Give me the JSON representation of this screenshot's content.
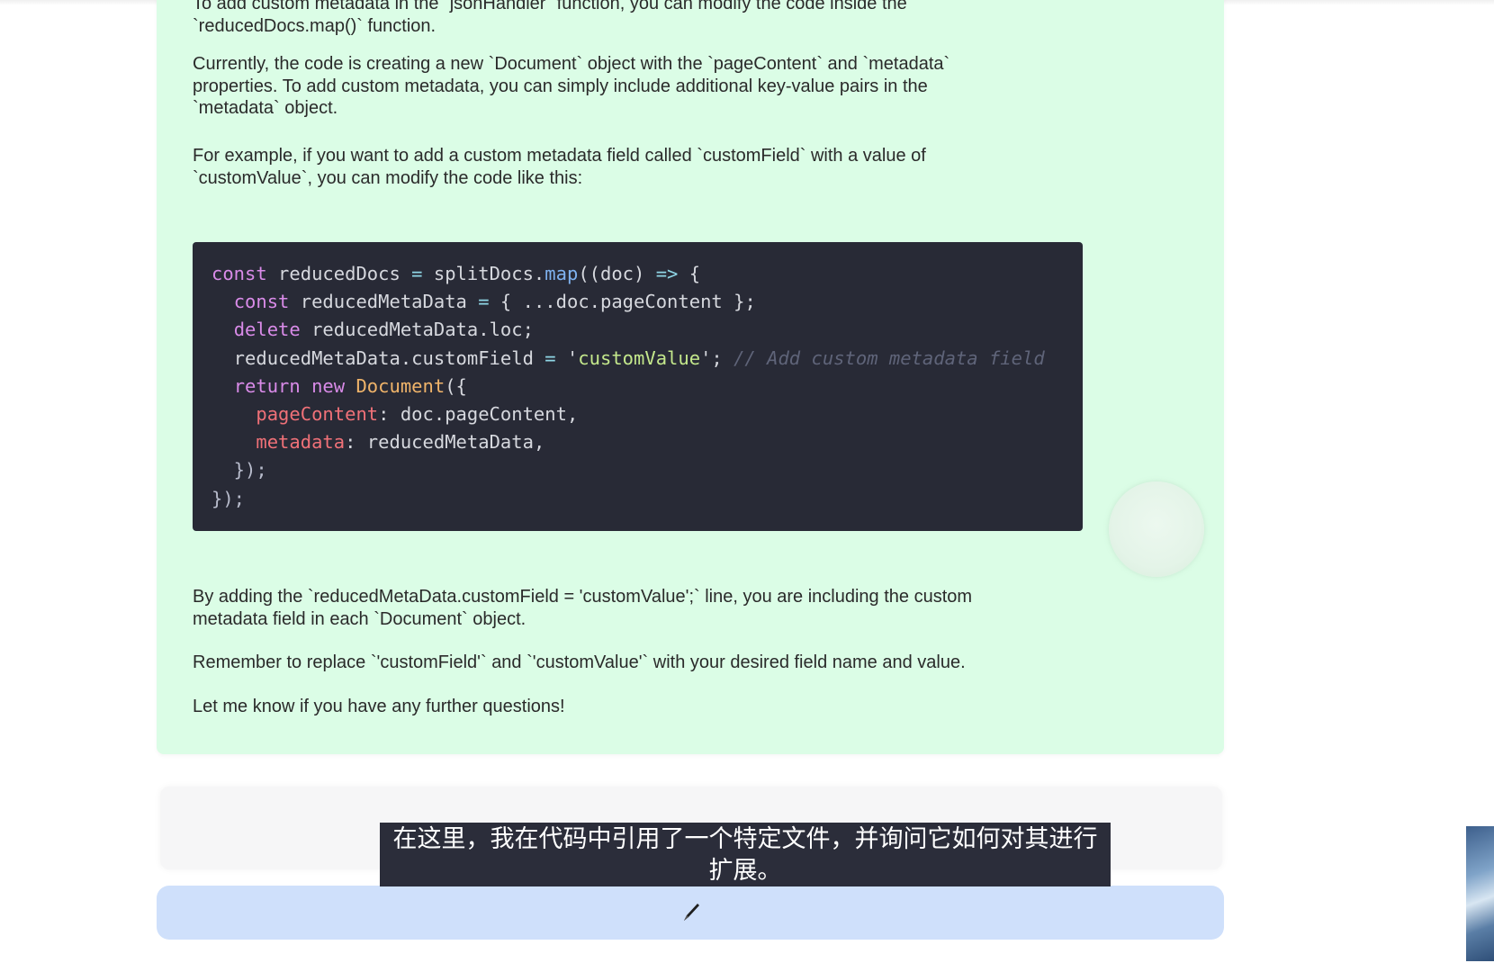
{
  "answer": {
    "paragraphs": [
      "To add custom metadata in the `jsonHandler` function, you can modify the code inside the\n`reducedDocs.map()` function.",
      "Currently, the code is creating a new `Document` object with the `pageContent` and `metadata`\nproperties. To add custom metadata, you can simply include additional key-value pairs in the\n`metadata` object.",
      "For example, if you want to add a custom metadata field called `customField` with a value of\n`customValue`, you can modify the code like this:",
      "By adding the `reducedMetaData.customField = 'customValue';` line, you are including the custom\nmetadata field in each `Document` object.",
      "Remember to replace `'customField'` and `'customValue'` with your desired field name and value.",
      "Let me know if you have any further questions!"
    ],
    "code_lines": [
      [
        {
          "t": "const",
          "c": "kw"
        },
        {
          "t": " reducedDocs ",
          "c": "plain"
        },
        {
          "t": "=",
          "c": "op"
        },
        {
          "t": " splitDocs.",
          "c": "plain"
        },
        {
          "t": "map",
          "c": "fn"
        },
        {
          "t": "((doc) ",
          "c": "plain"
        },
        {
          "t": "=>",
          "c": "op"
        },
        {
          "t": " {",
          "c": "plain"
        }
      ],
      [
        {
          "t": "  ",
          "c": "plain"
        },
        {
          "t": "const",
          "c": "kw"
        },
        {
          "t": " reducedMetaData ",
          "c": "plain"
        },
        {
          "t": "=",
          "c": "op"
        },
        {
          "t": " { ...doc.pageContent };",
          "c": "plain"
        }
      ],
      [
        {
          "t": "  ",
          "c": "plain"
        },
        {
          "t": "delete",
          "c": "kw"
        },
        {
          "t": " reducedMetaData.loc;",
          "c": "plain"
        }
      ],
      [
        {
          "t": "  reducedMetaData.customField ",
          "c": "plain"
        },
        {
          "t": "=",
          "c": "op"
        },
        {
          "t": " '",
          "c": "plain"
        },
        {
          "t": "customValue",
          "c": "str"
        },
        {
          "t": "'; ",
          "c": "plain"
        },
        {
          "t": "// Add custom metadata field",
          "c": "cmt"
        }
      ],
      [
        {
          "t": "  ",
          "c": "plain"
        },
        {
          "t": "return",
          "c": "kw"
        },
        {
          "t": " ",
          "c": "plain"
        },
        {
          "t": "new",
          "c": "kw"
        },
        {
          "t": " ",
          "c": "plain"
        },
        {
          "t": "Document",
          "c": "cls"
        },
        {
          "t": "({",
          "c": "plain"
        }
      ],
      [
        {
          "t": "    ",
          "c": "plain"
        },
        {
          "t": "pageContent",
          "c": "prop"
        },
        {
          "t": ": doc.pageContent,",
          "c": "plain"
        }
      ],
      [
        {
          "t": "    ",
          "c": "plain"
        },
        {
          "t": "metadata",
          "c": "prop"
        },
        {
          "t": ": reducedMetaData,",
          "c": "plain"
        }
      ],
      [
        {
          "t": "  });",
          "c": "punc"
        }
      ],
      [
        {
          "t": "});",
          "c": "punc"
        }
      ]
    ]
  },
  "subtitle": {
    "line1": "在这里，我在代码中引用了一个特定文件，并询问它如何对其进行",
    "line2": "扩展。"
  },
  "icons": {
    "send": "pencil-icon"
  },
  "colors": {
    "answer_bg": "#dbfde6",
    "code_bg": "#282a36",
    "send_bar": "#cfe0fb",
    "subtitle_bg": "#2b2d3a"
  }
}
